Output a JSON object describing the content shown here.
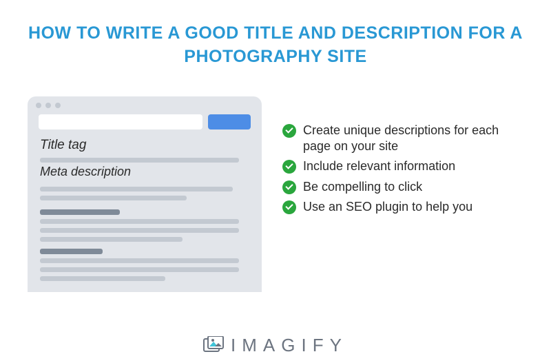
{
  "title": "HOW TO WRITE A GOOD TITLE AND DESCRIPTION FOR A PHOTOGRAPHY SITE",
  "mock": {
    "title_label": "Title tag",
    "meta_label": "Meta description"
  },
  "tips": [
    "Create unique descriptions for each page on your site",
    "Include relevant information",
    "Be compelling to click",
    "Use an SEO plugin to help you"
  ],
  "brand": "IMAGIFY"
}
